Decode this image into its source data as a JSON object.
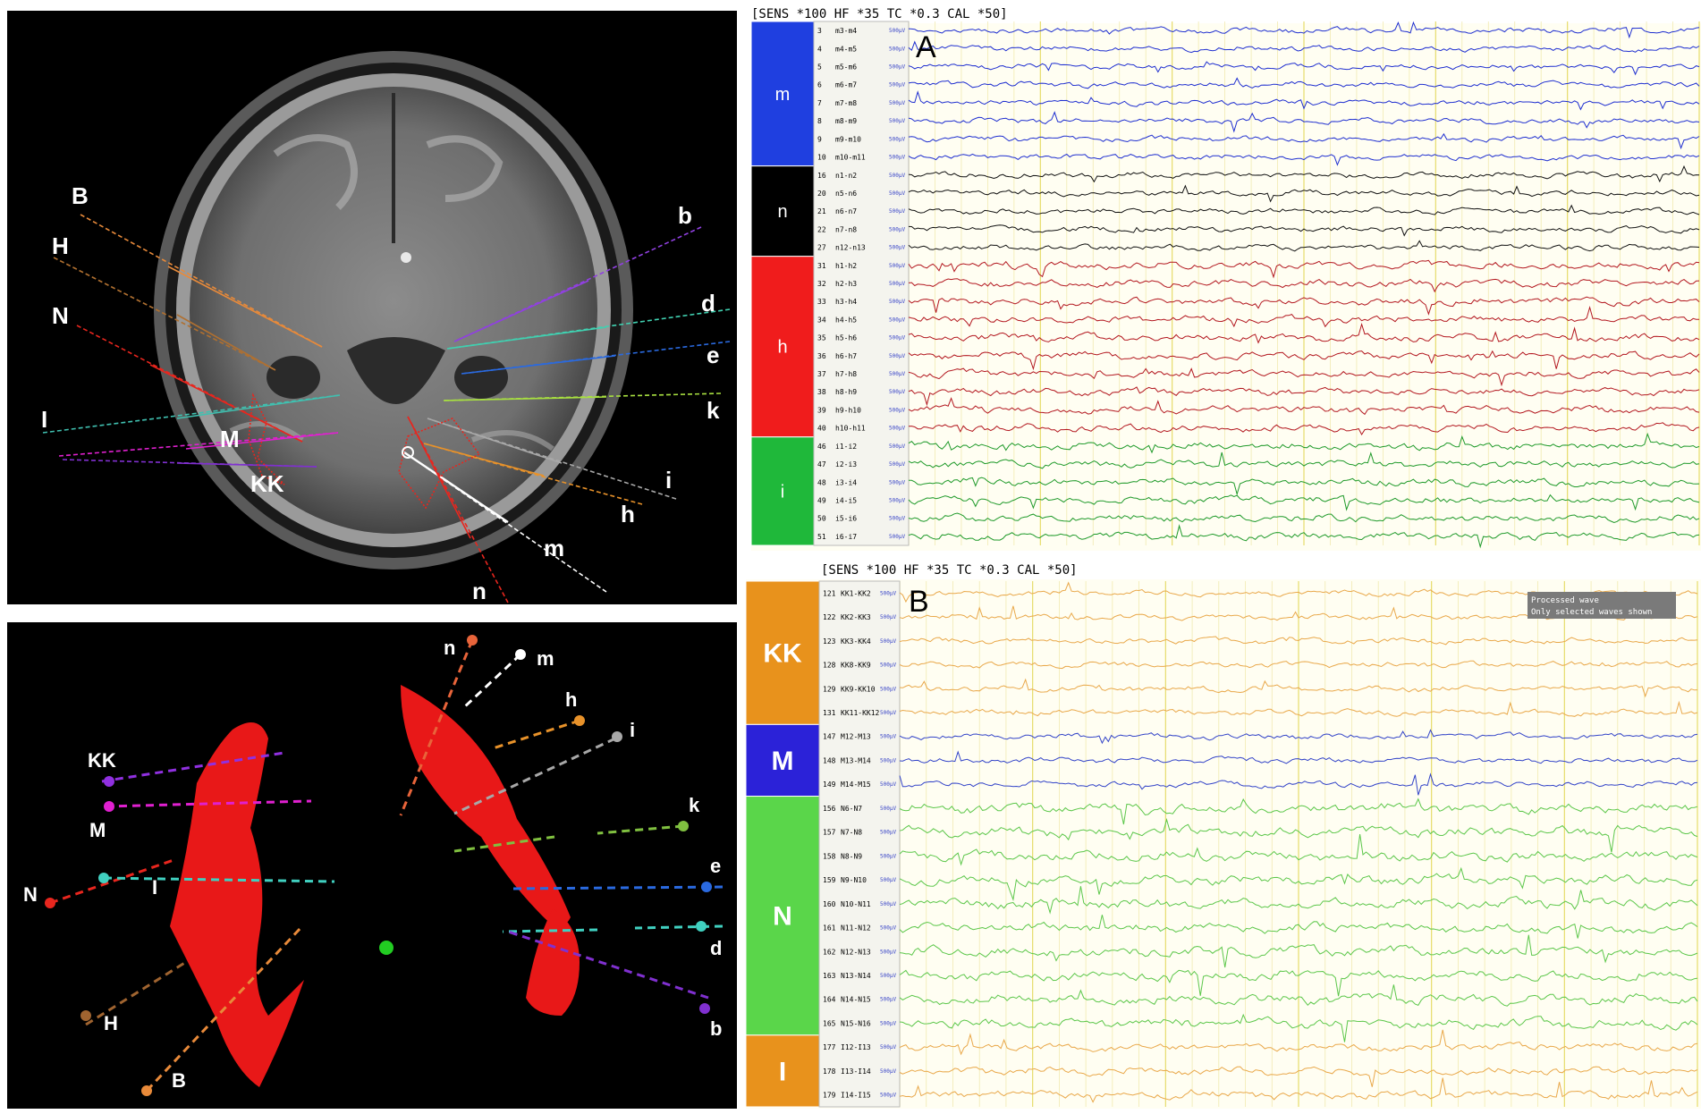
{
  "mri_panel": {
    "electrode_labels": [
      "B",
      "H",
      "N",
      "I",
      "M",
      "KK",
      "b",
      "d",
      "e",
      "k",
      "i",
      "h",
      "m",
      "n"
    ]
  },
  "recon_panel": {
    "electrode_labels": [
      "n",
      "m",
      "h",
      "i",
      "KK",
      "M",
      "k",
      "N",
      "I",
      "e",
      "d",
      "H",
      "b",
      "B"
    ]
  },
  "eeg_a": {
    "panel_letter": "A",
    "header": "[SENS *100  HF *35  TC *0.3  CAL *50]",
    "calibration": "500µV",
    "groups": [
      {
        "label": "m",
        "color": "#1f3fe0",
        "trace_color": "#1f2fd0",
        "channels": [
          {
            "num": "3",
            "name": "m3-m4"
          },
          {
            "num": "4",
            "name": "m4-m5"
          },
          {
            "num": "5",
            "name": "m5-m6"
          },
          {
            "num": "6",
            "name": "m6-m7"
          },
          {
            "num": "7",
            "name": "m7-m8"
          },
          {
            "num": "8",
            "name": "m8-m9"
          },
          {
            "num": "9",
            "name": "m9-m10"
          },
          {
            "num": "10",
            "name": "m10-m11"
          }
        ]
      },
      {
        "label": "n",
        "color": "#000000",
        "trace_color": "#111111",
        "channels": [
          {
            "num": "16",
            "name": "n1-n2"
          },
          {
            "num": "20",
            "name": "n5-n6"
          },
          {
            "num": "21",
            "name": "n6-n7"
          },
          {
            "num": "22",
            "name": "n7-n8"
          },
          {
            "num": "27",
            "name": "n12-n13"
          }
        ]
      },
      {
        "label": "h",
        "color": "#f01c1c",
        "trace_color": "#b3171f",
        "channels": [
          {
            "num": "31",
            "name": "h1-h2"
          },
          {
            "num": "32",
            "name": "h2-h3"
          },
          {
            "num": "33",
            "name": "h3-h4"
          },
          {
            "num": "34",
            "name": "h4-h5"
          },
          {
            "num": "35",
            "name": "h5-h6"
          },
          {
            "num": "36",
            "name": "h6-h7"
          },
          {
            "num": "37",
            "name": "h7-h8"
          },
          {
            "num": "38",
            "name": "h8-h9"
          },
          {
            "num": "39",
            "name": "h9-h10"
          },
          {
            "num": "40",
            "name": "h10-h11"
          }
        ]
      },
      {
        "label": "i",
        "color": "#1fb83a",
        "trace_color": "#1f9a2a",
        "channels": [
          {
            "num": "46",
            "name": "i1-i2"
          },
          {
            "num": "47",
            "name": "i2-i3"
          },
          {
            "num": "48",
            "name": "i3-i4"
          },
          {
            "num": "49",
            "name": "i4-i5"
          },
          {
            "num": "50",
            "name": "i5-i6"
          },
          {
            "num": "51",
            "name": "i6-i7"
          }
        ]
      }
    ]
  },
  "eeg_b": {
    "panel_letter": "B",
    "header": "[SENS *100  HF *35  TC *0.3  CAL *50]",
    "calibration": "500µV",
    "note_line1": "Processed wave",
    "note_line2": "Only selected waves shown",
    "groups": [
      {
        "label": "KK",
        "color": "#e8921c",
        "trace_color": "#e9a84a",
        "channels": [
          {
            "num": "121",
            "name": "KK1-KK2"
          },
          {
            "num": "122",
            "name": "KK2-KK3"
          },
          {
            "num": "123",
            "name": "KK3-KK4"
          },
          {
            "num": "128",
            "name": "KK8-KK9"
          },
          {
            "num": "129",
            "name": "KK9-KK10"
          },
          {
            "num": "131",
            "name": "KK11-KK12"
          }
        ]
      },
      {
        "label": "M",
        "color": "#2b22d8",
        "trace_color": "#3344c8",
        "channels": [
          {
            "num": "147",
            "name": "M12-M13"
          },
          {
            "num": "148",
            "name": "M13-M14"
          },
          {
            "num": "149",
            "name": "M14-M15"
          }
        ]
      },
      {
        "label": "N",
        "color": "#5ad64a",
        "trace_color": "#5cc74a",
        "channels": [
          {
            "num": "156",
            "name": "N6-N7"
          },
          {
            "num": "157",
            "name": "N7-N8"
          },
          {
            "num": "158",
            "name": "N8-N9"
          },
          {
            "num": "159",
            "name": "N9-N10"
          },
          {
            "num": "160",
            "name": "N10-N11"
          },
          {
            "num": "161",
            "name": "N11-N12"
          },
          {
            "num": "162",
            "name": "N12-N13"
          },
          {
            "num": "163",
            "name": "N13-N14"
          },
          {
            "num": "164",
            "name": "N14-N15"
          },
          {
            "num": "165",
            "name": "N15-N16"
          }
        ]
      },
      {
        "label": "I",
        "color": "#e8921c",
        "trace_color": "#e9a84a",
        "channels": [
          {
            "num": "177",
            "name": "I12-I13"
          },
          {
            "num": "178",
            "name": "I13-I14"
          },
          {
            "num": "179",
            "name": "I14-I15"
          }
        ]
      }
    ]
  }
}
